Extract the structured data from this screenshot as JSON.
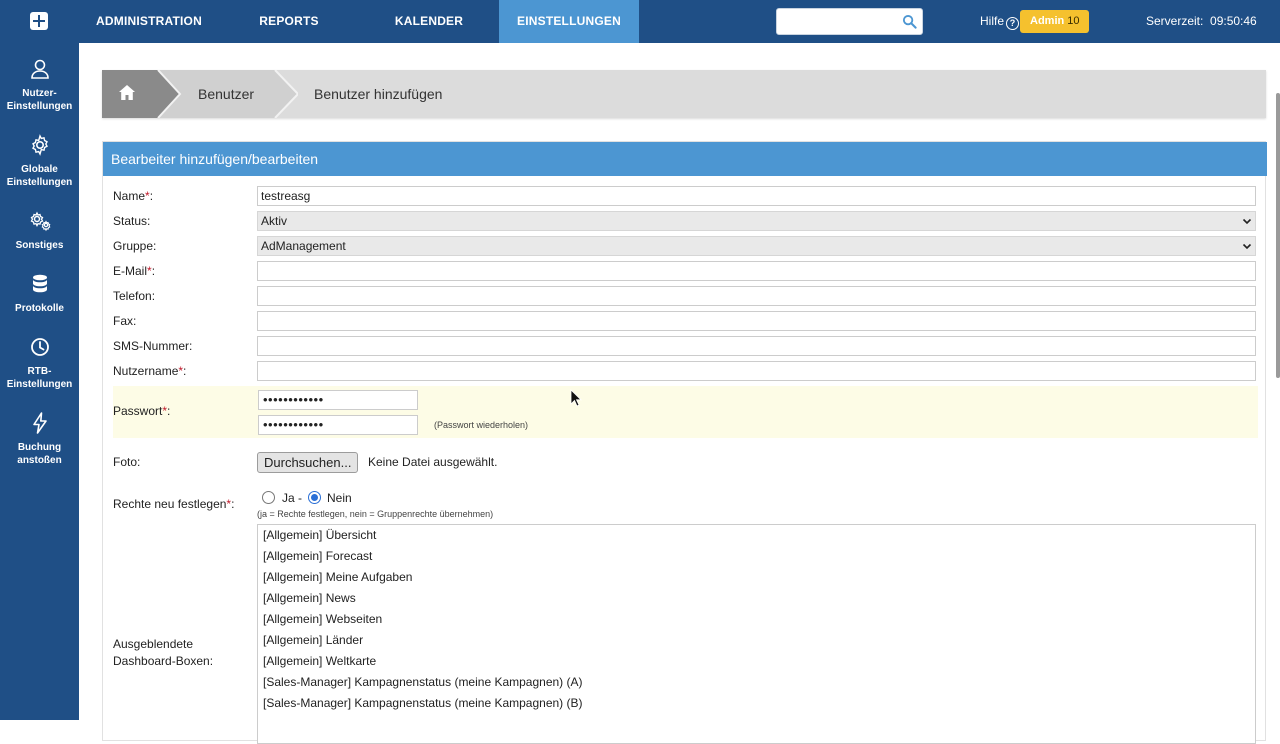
{
  "nav": {
    "items": [
      {
        "label": "ADMINISTRATION"
      },
      {
        "label": "REPORTS"
      },
      {
        "label": "KALENDER"
      },
      {
        "label": "EINSTELLUNGEN",
        "active": true
      }
    ],
    "search_placeholder": "",
    "hilfe": "Hilfe",
    "admin_label": "Admin",
    "admin_count": "10",
    "serverzeit": "Serverzeit:  09:50:46"
  },
  "sidebar": {
    "items": [
      {
        "label": "Nutzer-\nEinstellungen",
        "icon": "user-icon"
      },
      {
        "label": "Globale\nEinstellungen",
        "icon": "gear-icon"
      },
      {
        "label": "Sonstiges",
        "icon": "gears-icon"
      },
      {
        "label": "Protokolle",
        "icon": "database-icon"
      },
      {
        "label": "RTB-\nEinstellungen",
        "icon": "clock-icon"
      },
      {
        "label": "Buchung\nanstoßen",
        "icon": "bolt-icon"
      }
    ]
  },
  "breadcrumb": {
    "home_icon": "home-icon",
    "items": [
      "Benutzer",
      "Benutzer hinzufügen"
    ]
  },
  "form": {
    "title": "Bearbeiter hinzufügen/bearbeiten",
    "name_label": "Name",
    "name_value": "testreasg",
    "status_label": "Status:",
    "status_value": "Aktiv",
    "gruppe_label": "Gruppe:",
    "gruppe_value": "AdManagement",
    "email_label": "E-Mail",
    "email_value": "",
    "telefon_label": "Telefon:",
    "telefon_value": "",
    "fax_label": "Fax:",
    "fax_value": "",
    "sms_label": "SMS-Nummer:",
    "sms_value": "",
    "nutzername_label": "Nutzername",
    "nutzername_value": "",
    "passwort_label": "Passwort",
    "passwort_mask": "••••••••••••",
    "passwort_repeat_mask": "••••••••••••",
    "passwort_hint": "(Passwort wiederholen)",
    "foto_label": "Foto:",
    "foto_button": "Durchsuchen...",
    "foto_status": "Keine Datei ausgewählt.",
    "rechte_label": "Rechte neu festlegen",
    "rechte_ja": "Ja -",
    "rechte_nein": "Nein",
    "rechte_selected": "Nein",
    "rechte_hint": "(ja = Rechte festlegen, nein = Gruppenrechte übernehmen)",
    "dashboard_label_1": "Ausgeblendete",
    "dashboard_label_2": "Dashboard-Boxen:",
    "dashboard_items": [
      "[Allgemein] Übersicht",
      "[Allgemein] Forecast",
      "[Allgemein] Meine Aufgaben",
      "[Allgemein] News",
      "[Allgemein] Webseiten",
      "[Allgemein] Länder",
      "[Allgemein] Weltkarte",
      "[Sales-Manager] Kampagnenstatus (meine Kampagnen) (A)",
      "[Sales-Manager] Kampagnenstatus (meine Kampagnen) (B)"
    ]
  },
  "colors": {
    "nav_bg": "#1f4f86",
    "accent": "#4c96d2",
    "admin_badge": "#f5c12e",
    "password_row_bg": "#fdfce6",
    "required": "#c0192a"
  }
}
